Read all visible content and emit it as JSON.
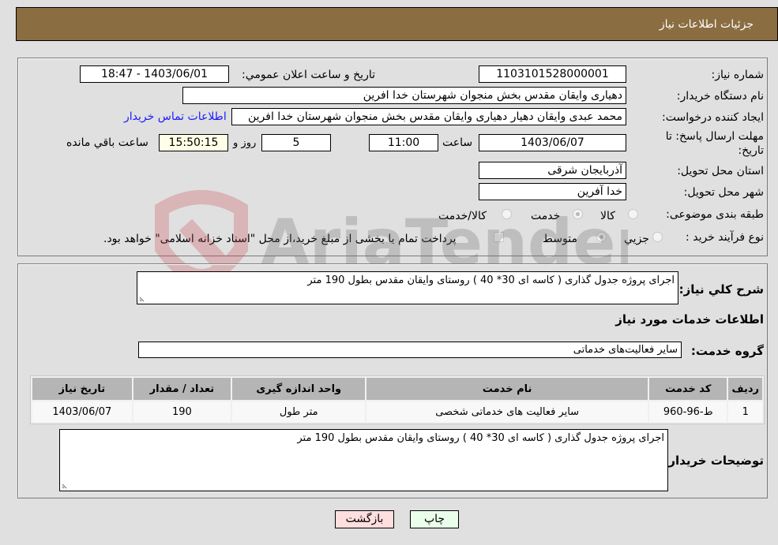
{
  "header": {
    "title": "جزئیات اطلاعات نیاز"
  },
  "info": {
    "need_number_label": "شماره نیاز:",
    "need_number": "1103101528000001",
    "announce_label": "تاریخ و ساعت اعلان عمومي:",
    "announce_value": "1403/06/01 - 18:47",
    "buyer_org_label": "نام دستگاه خریدار:",
    "buyer_org": "دهیاری وایقان مقدس بخش منجوان شهرستان خدا افرین",
    "creator_label": "ایجاد کننده درخواست:",
    "creator": "محمد عبدی وایقان دهیار دهیاری وایقان مقدس بخش منجوان شهرستان خدا افرین",
    "contact_link": "اطلاعات تماس خریدار",
    "deadline_label": "مهلت ارسال پاسخ: تا تاریخ:",
    "deadline_date": "1403/06/07",
    "time_label": "ساعت",
    "deadline_time": "11:00",
    "days": "5",
    "days_suffix": "روز و",
    "remaining_time": "15:50:15",
    "remaining_suffix": "ساعت باقي مانده",
    "province_label": "استان محل تحویل:",
    "province": "آذربایجان شرقی",
    "city_label": "شهر محل تحویل:",
    "city": "خدا آفرین",
    "category_label": "طبقه بندی موضوعی:",
    "category_options": [
      {
        "label": "کالا",
        "checked": false
      },
      {
        "label": "خدمت",
        "checked": true
      },
      {
        "label": "کالا/خدمت",
        "checked": false
      }
    ],
    "process_label": "نوع فرآیند خرید :",
    "process_options": [
      {
        "label": "جزيي",
        "checked": false
      },
      {
        "label": "متوسط",
        "checked": true
      }
    ],
    "treasury_note": "پرداخت تمام یا بخشی از مبلغ خرید،از محل \"اسناد خزانه اسلامی\" خواهد بود.",
    "treasury_checked": false
  },
  "details": {
    "summary_label": "شرح کلي نیاز:",
    "summary": "اجرای پروژه جدول گذاری ( کاسه ای 30* 40 ) روستای وایقان مقدس بطول 190 متر",
    "services_heading": "اطلاعات خدمات مورد نیاز",
    "service_group_label": "گروه خدمت:",
    "service_group": "سایر فعالیت‌های خدماتی",
    "table": {
      "headers": [
        "ردیف",
        "کد خدمت",
        "نام خدمت",
        "واحد اندازه گیری",
        "تعداد / مقدار",
        "تاریخ نیاز"
      ],
      "rows": [
        [
          "1",
          "ط-96-960",
          "سایر فعالیت های خدماتی شخصی",
          "متر طول",
          "190",
          "1403/06/07"
        ]
      ]
    },
    "buyer_notes_label": "توضیحات خریدار:",
    "buyer_notes": "اجرای پروژه جدول گذاری ( کاسه ای 30* 40 ) روستای وایقان مقدس بطول 190 متر"
  },
  "buttons": {
    "print": "چاپ",
    "back": "بازگشت"
  },
  "watermark": {
    "text": "AriaTender.neT"
  },
  "colors": {
    "header_bg": "#8b6d42",
    "print_bg": "#eaffea",
    "back_bg": "#ffdede",
    "remaining_bg": "#ffffe8",
    "link": "#1a1aff"
  }
}
